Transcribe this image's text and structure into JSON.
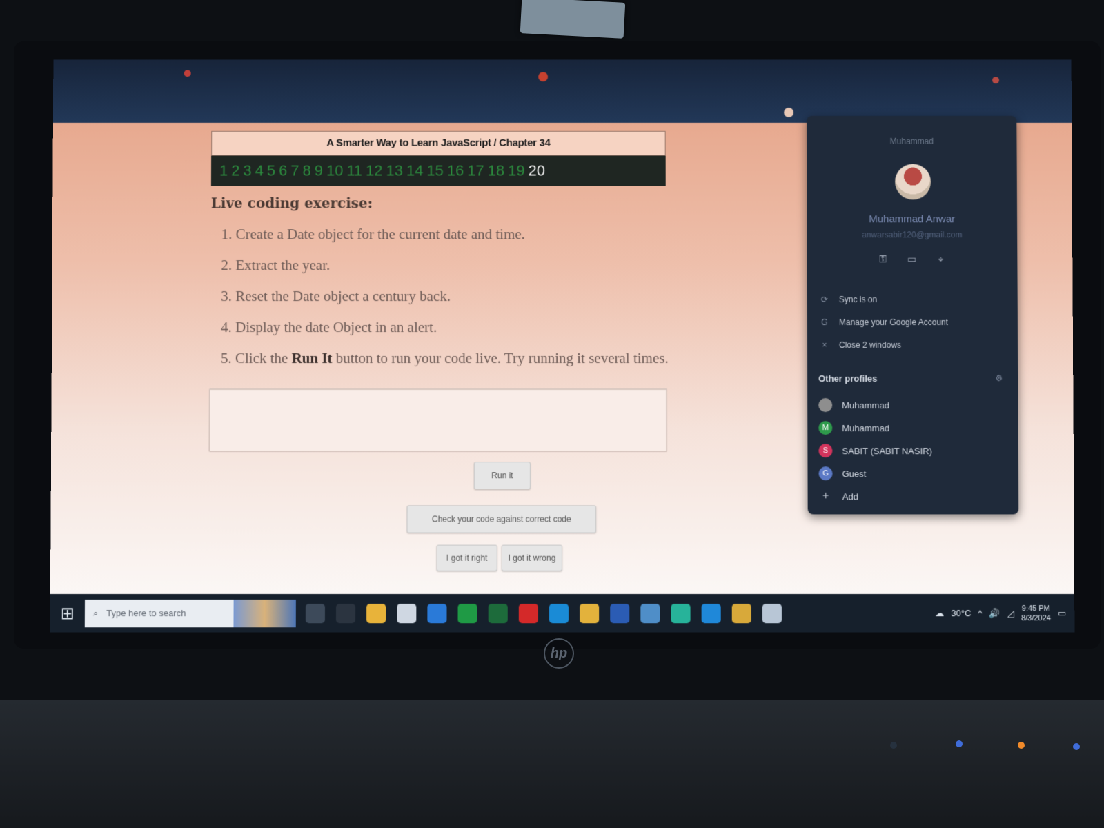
{
  "book": {
    "title": "A Smarter Way to Learn JavaScript  /  Chapter 34",
    "chapters": [
      "1",
      "2",
      "3",
      "4",
      "5",
      "6",
      "7",
      "8",
      "9",
      "10",
      "11",
      "12",
      "13",
      "14",
      "15",
      "16",
      "17",
      "18",
      "19",
      "20"
    ],
    "current_chapter": "20"
  },
  "exercise": {
    "heading": "Live coding exercise:",
    "steps": [
      {
        "num": "1.",
        "text": "Create a Date object for the current date and time."
      },
      {
        "num": "2.",
        "text": "Extract the year."
      },
      {
        "num": "3.",
        "text": "Reset the Date object a century back."
      },
      {
        "num": "4.",
        "text": "Display the date Object in an alert."
      },
      {
        "num": "5.",
        "pre": "Click the ",
        "bold": "Run It",
        "post": " button to run your code live. Try running it several times."
      }
    ],
    "code_value": "",
    "run_label": "Run it",
    "check_label": "Check your code against correct code",
    "right_label": "I got it right",
    "wrong_label": "I got it wrong"
  },
  "profile_panel": {
    "top_name": "Muhammad",
    "name": "Muhammad Anwar",
    "email": "anwarsabir120@gmail.com",
    "menu": [
      {
        "icon": "sync-icon",
        "label": "Sync is on"
      },
      {
        "icon": "google-icon",
        "label": "Manage your Google Account"
      },
      {
        "icon": "close-icon",
        "label": "Close 2 windows"
      }
    ],
    "other_profiles_title": "Other profiles",
    "profiles": [
      {
        "label": "Muhammad",
        "color": "#8e8e8e",
        "initial": ""
      },
      {
        "label": "Muhammad",
        "color": "#2e9a4b",
        "initial": "M"
      },
      {
        "label": "SABIT (SABIT NASIR)",
        "color": "#d2345c",
        "initial": "S"
      },
      {
        "label": "Guest",
        "color": "#5b79c5",
        "initial": "G"
      },
      {
        "label": "Add",
        "color": "transparent",
        "initial": "+"
      }
    ]
  },
  "taskbar": {
    "search_placeholder": "Type here to search",
    "weather": "30°C",
    "time": "9:45 PM",
    "date": "8/3/2024",
    "app_icons": [
      {
        "name": "task-view-icon",
        "color": "#3d4a5a"
      },
      {
        "name": "widgets-icon",
        "color": "#2b3440"
      },
      {
        "name": "file-explorer-icon",
        "color": "#e8b33a"
      },
      {
        "name": "calendar-icon",
        "color": "#cfd7e2"
      },
      {
        "name": "mail-icon",
        "color": "#2a7ad8"
      },
      {
        "name": "sheets-icon",
        "color": "#1f9a45"
      },
      {
        "name": "excel-icon",
        "color": "#1d6b3b"
      },
      {
        "name": "youtube-icon",
        "color": "#d42929"
      },
      {
        "name": "edge-icon",
        "color": "#1a8bd6"
      },
      {
        "name": "chrome-icon",
        "color": "#e3b23c"
      },
      {
        "name": "word-icon",
        "color": "#2b5cb4"
      },
      {
        "name": "notepad-icon",
        "color": "#4f8ec8"
      },
      {
        "name": "app-diamond-icon",
        "color": "#27b39a"
      },
      {
        "name": "vscode-icon",
        "color": "#1f88d9"
      },
      {
        "name": "chrome-active-icon",
        "color": "#d8a93a"
      },
      {
        "name": "onedrive-icon",
        "color": "#b8c6d6"
      }
    ]
  }
}
